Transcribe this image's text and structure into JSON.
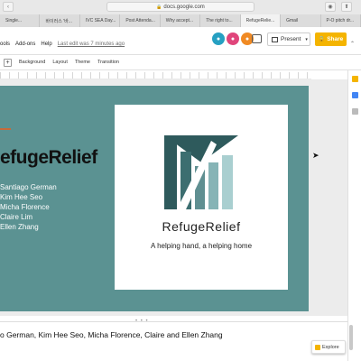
{
  "browser": {
    "url": "docs.google.com",
    "tabs": [
      {
        "label": "Single..."
      },
      {
        "label": "바이러스 '바..."
      },
      {
        "label": "IVC SEA Day..."
      },
      {
        "label": "Post Attenda..."
      },
      {
        "label": "Why accept..."
      },
      {
        "label": "The right to..."
      },
      {
        "label": "RefugeRelie...",
        "active": true
      },
      {
        "label": "Gmail"
      },
      {
        "label": "P-O pitch dr..."
      }
    ]
  },
  "header": {
    "menu_tools": "ools",
    "menu_addons": "Add-ons",
    "menu_help": "Help",
    "last_edit": "Last edit was 7 minutes ago",
    "present_label": "Present",
    "share_label": "Share"
  },
  "toolbar": {
    "background_label": "Background",
    "layout_label": "Layout",
    "theme_label": "Theme",
    "transition_label": "Transition"
  },
  "slide": {
    "title": "efugeRelief",
    "names": [
      "Santiago German",
      "Kim Hee Seo",
      "Micha Florence",
      "Claire Lim",
      "Ellen Zhang"
    ],
    "logo_name": "RefugeRelief",
    "logo_tagline": "A helping hand, a helping home"
  },
  "notes": {
    "text": "o German, Kim Hee Seo, Micha Florence, Claire and Ellen Zhang"
  },
  "explore_label": "Explore",
  "colors": {
    "slide_bg": "#5b9292",
    "share_yellow": "#f4b400",
    "logo_dark": "#2e5a5c",
    "logo_light": "#a9cfd0"
  },
  "icons": {
    "comment": "comment-icon",
    "present": "present-icon",
    "lock": "lock-icon",
    "explore": "explore-icon"
  }
}
